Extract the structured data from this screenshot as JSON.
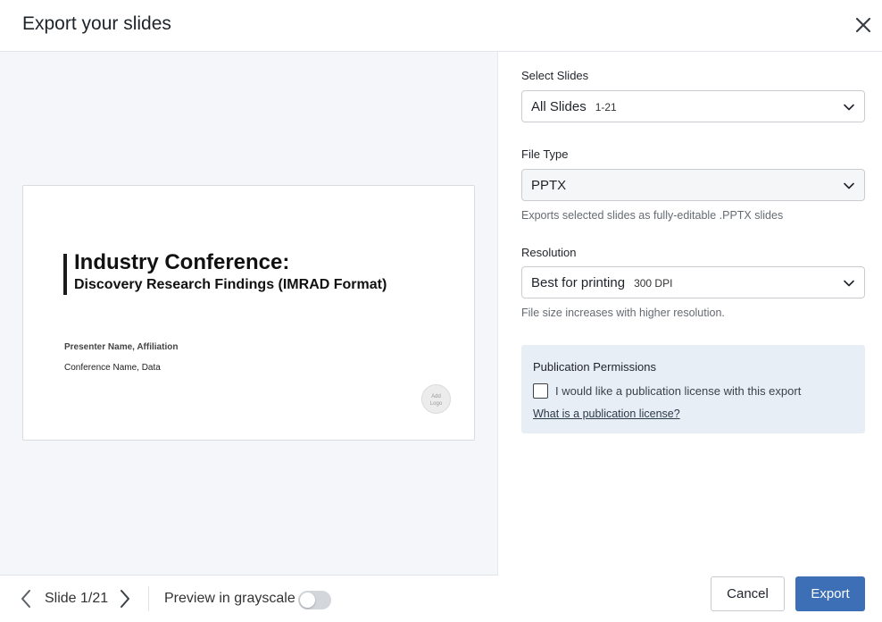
{
  "dialog": {
    "title": "Export your slides",
    "close_icon": "close-icon"
  },
  "preview": {
    "slide": {
      "title": "Industry Conference:",
      "subtitle": "Discovery Research Findings (IMRAD Format)",
      "presenter": "Presenter Name, Affiliation",
      "conference": "Conference Name, Data",
      "logo_placeholder": "Add\nLogo"
    },
    "footer": {
      "slide_counter": "Slide 1/21",
      "grayscale_label": "Preview in grayscale",
      "grayscale_on": false,
      "prev_icon": "chevron-left-icon",
      "next_icon": "chevron-right-icon"
    }
  },
  "settings": {
    "select_slides": {
      "label": "Select Slides",
      "value": "All Slides",
      "sub_value": "1-21"
    },
    "file_type": {
      "label": "File Type",
      "value": "PPTX",
      "helper": "Exports selected slides as fully-editable .PPTX slides"
    },
    "resolution": {
      "label": "Resolution",
      "value": "Best for printing",
      "sub_value": "300 DPI",
      "helper": "File size increases with higher resolution."
    },
    "permissions": {
      "title": "Publication Permissions",
      "checkbox_label": "I would like a publication license with this export",
      "checked": false,
      "link": "What is a publication license?"
    }
  },
  "actions": {
    "cancel": "Cancel",
    "export": "Export"
  },
  "colors": {
    "primary": "#3d6fb6",
    "preview_bg": "#f4f6f9",
    "permission_bg": "#e8eef6"
  }
}
